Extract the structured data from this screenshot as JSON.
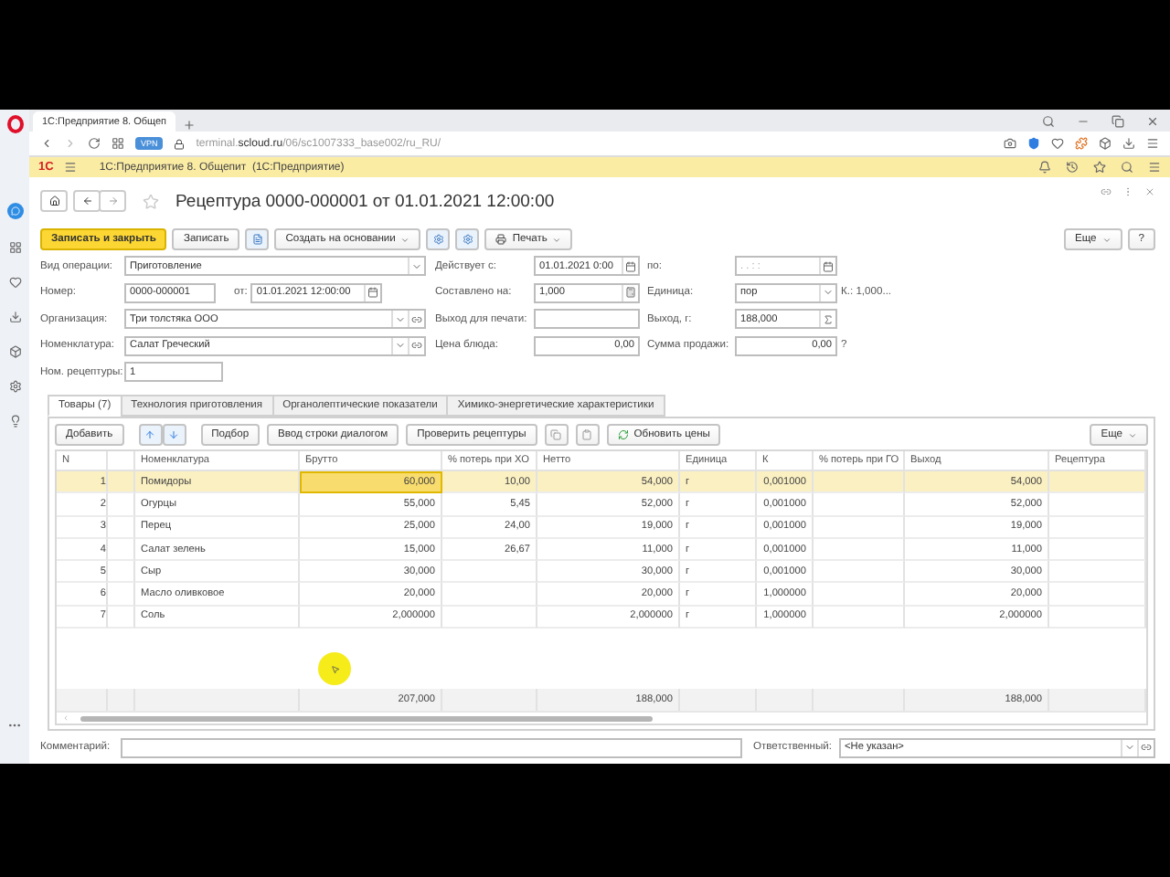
{
  "browser": {
    "tab_title": "1С:Предприятие 8. Общеп",
    "vpn_badge": "VPN",
    "url": "terminal.**scloud.ru**/06/sc1007333_base002/ru_RU/"
  },
  "app_bar": {
    "logo": "1С",
    "title": "1С:Предприятие 8. Общепит  (1С:Предприятие)"
  },
  "form": {
    "title": "Рецептура 0000-000001 от 01.01.2021 12:00:00",
    "toolbar": {
      "save_close": "Записать и закрыть",
      "save": "Записать",
      "create_based_on": "Создать на основании",
      "print": "Печать",
      "more": "Еще",
      "help": "?"
    },
    "field_rows": [
      {
        "left": {
          "label": "Вид операции:",
          "value": "Приготовление",
          "numeric": false,
          "dropdown": true
        },
        "middle": {
          "label": "Действует с:",
          "value": "01.01.2021 0:00",
          "numeric": false,
          "calendar": true
        },
        "right": {
          "label": "по:",
          "placeholder": " .  .     :  :",
          "numeric": false,
          "calendar": true
        }
      },
      {
        "left": {
          "label": "Номер:",
          "value": "0000-000001",
          "numeric": false,
          "extra": {
            "label": "от:",
            "value": "01.01.2021 12:00:00",
            "calendar": true
          }
        },
        "middle": {
          "label": "Составлено на:",
          "value": "1,000",
          "numeric": true,
          "calculator": true
        },
        "right": {
          "label": "Единица:",
          "value": "пор",
          "numeric": false,
          "dropdown": true,
          "suffix": "К.: 1,000..."
        }
      },
      {
        "left": {
          "label": "Организация:",
          "value": "Три толстяка ООО",
          "numeric": false,
          "dropdown": true,
          "open": true
        },
        "middle": {
          "label": "Выход для печати:"
        },
        "right": {
          "label": "Выход, г:",
          "value": "188,000",
          "numeric": true,
          "sum": true
        }
      },
      {
        "left": {
          "label": "Номенклатура:",
          "value": "Салат Греческий",
          "numeric": false,
          "dropdown": true,
          "open": true
        },
        "middle": {
          "label": "Цена блюда:",
          "value": "0,00",
          "numeric": true
        },
        "right": {
          "label": "Сумма продажи:",
          "value": "0,00",
          "numeric": true,
          "suffix": "?"
        }
      },
      {
        "left": {
          "label": "Ном. рецептуры:",
          "value": "1",
          "numeric": false,
          "short": true
        }
      }
    ],
    "tabs": [
      {
        "label": "Товары (7)",
        "selected": true
      },
      {
        "label": "Технология приготовления",
        "selected": false
      },
      {
        "label": "Органолептические показатели",
        "selected": false
      },
      {
        "label": "Химико-энергетические характеристики",
        "selected": false
      }
    ],
    "table_toolbar": {
      "add": "Добавить",
      "pick": "Подбор",
      "dialog_entry": "Ввод строки диалогом",
      "check": "Проверить рецептуры",
      "update_prices": "Обновить цены",
      "more": "Еще"
    },
    "table": {
      "columns": [
        {
          "title": "N",
          "numeric": true,
          "current": false
        },
        {
          "numeric": false,
          "current": false
        },
        {
          "title": "Номенклатура",
          "numeric": false,
          "current": false
        },
        {
          "title": "Брутто",
          "numeric": true,
          "current": true
        },
        {
          "title": "% потерь при ХО",
          "numeric": true,
          "current": false
        },
        {
          "title": "Нетто",
          "numeric": true,
          "current": false
        },
        {
          "title": "Единица",
          "numeric": false,
          "current": false
        },
        {
          "title": "К",
          "numeric": true,
          "current": false
        },
        {
          "title": "% потерь при ГО",
          "numeric": true,
          "current": false
        },
        {
          "title": "Выход",
          "numeric": true,
          "current": false
        },
        {
          "title": "Рецептура",
          "numeric": false,
          "current": false
        }
      ],
      "rows": [
        {
          "selected": true,
          "n": "1",
          "item": "Помидоры",
          "brutto": "60,000",
          "loss_xo": "10,00",
          "netto": "54,000",
          "unit": "г",
          "k": "0,001000",
          "output": "54,000"
        },
        {
          "selected": false,
          "n": "2",
          "item": "Огурцы",
          "brutto": "55,000",
          "loss_xo": "5,45",
          "netto": "52,000",
          "unit": "г",
          "k": "0,001000",
          "output": "52,000"
        },
        {
          "selected": false,
          "n": "3",
          "item": "Перец",
          "brutto": "25,000",
          "loss_xo": "24,00",
          "netto": "19,000",
          "unit": "г",
          "k": "0,001000",
          "output": "19,000"
        },
        {
          "selected": false,
          "n": "4",
          "item": "Салат зелень",
          "brutto": "15,000",
          "loss_xo": "26,67",
          "netto": "11,000",
          "unit": "г",
          "k": "0,001000",
          "output": "11,000"
        },
        {
          "selected": false,
          "n": "5",
          "item": "Сыр",
          "brutto": "30,000",
          "netto": "30,000",
          "unit": "г",
          "k": "0,001000",
          "output": "30,000"
        },
        {
          "selected": false,
          "n": "6",
          "item": "Масло оливковое",
          "brutto": "20,000",
          "netto": "20,000",
          "unit": "г",
          "k": "1,000000",
          "output": "20,000"
        },
        {
          "selected": false,
          "n": "7",
          "item": "Соль",
          "brutto": "2,000000",
          "netto": "2,000000",
          "unit": "г",
          "k": "1,000000",
          "output": "2,000000"
        }
      ],
      "totals": {
        "brutto": "207,000",
        "netto": "188,000",
        "output": "188,000"
      }
    },
    "comment": {
      "label": "Комментарий:"
    },
    "responsible": {
      "label": "Ответственный:",
      "value": "<Не указан>"
    }
  }
}
